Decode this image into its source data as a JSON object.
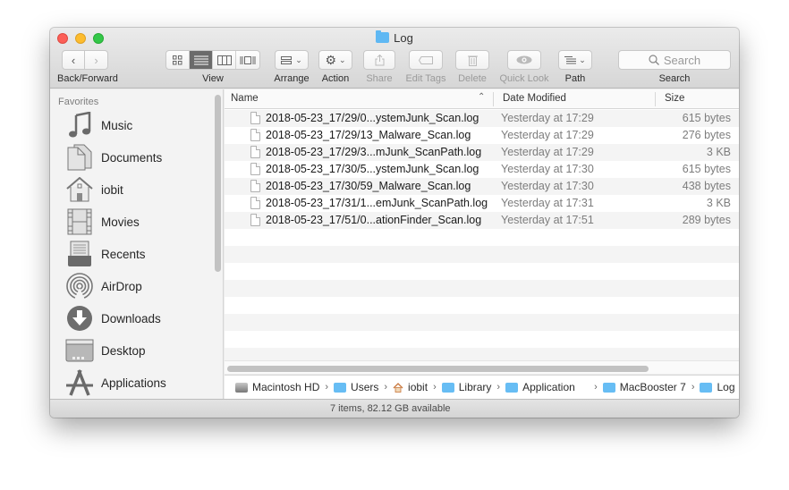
{
  "window": {
    "title": "Log",
    "title_icon": "folder-icon"
  },
  "toolbar": {
    "back_forward_label": "Back/Forward",
    "view_label": "View",
    "view_modes": [
      {
        "name": "icon-view",
        "icon": "grid-icon",
        "active": false
      },
      {
        "name": "list-view",
        "icon": "list-icon",
        "active": true
      },
      {
        "name": "column-view",
        "icon": "columns-icon",
        "active": false
      },
      {
        "name": "cover-flow-view",
        "icon": "cover-flow-icon",
        "active": false
      }
    ],
    "arrange_label": "Arrange",
    "action_label": "Action",
    "share_label": "Share",
    "edit_tags_label": "Edit Tags",
    "delete_label": "Delete",
    "quick_look_label": "Quick Look",
    "path_label": "Path",
    "search_label": "Search",
    "search_placeholder": "Search"
  },
  "sidebar": {
    "heading": "Favorites",
    "items": [
      {
        "label": "Music",
        "icon": "music-icon"
      },
      {
        "label": "Documents",
        "icon": "documents-icon"
      },
      {
        "label": "iobit",
        "icon": "home-icon"
      },
      {
        "label": "Movies",
        "icon": "movies-icon"
      },
      {
        "label": "Recents",
        "icon": "recents-icon"
      },
      {
        "label": "AirDrop",
        "icon": "airdrop-icon"
      },
      {
        "label": "Downloads",
        "icon": "downloads-icon"
      },
      {
        "label": "Desktop",
        "icon": "desktop-icon"
      },
      {
        "label": "Applications",
        "icon": "applications-icon"
      }
    ]
  },
  "columns": {
    "name": "Name",
    "date": "Date Modified",
    "size": "Size",
    "sort_indicator": "^"
  },
  "files": [
    {
      "name": "2018-05-23_17/29/0...ystemJunk_Scan.log",
      "date": "Yesterday at 17:29",
      "size": "615 bytes"
    },
    {
      "name": "2018-05-23_17/29/13_Malware_Scan.log",
      "date": "Yesterday at 17:29",
      "size": "276 bytes"
    },
    {
      "name": "2018-05-23_17/29/3...mJunk_ScanPath.log",
      "date": "Yesterday at 17:29",
      "size": "3 KB"
    },
    {
      "name": "2018-05-23_17/30/5...ystemJunk_Scan.log",
      "date": "Yesterday at 17:30",
      "size": "615 bytes"
    },
    {
      "name": "2018-05-23_17/30/59_Malware_Scan.log",
      "date": "Yesterday at 17:30",
      "size": "438 bytes"
    },
    {
      "name": "2018-05-23_17/31/1...emJunk_ScanPath.log",
      "date": "Yesterday at 17:31",
      "size": "3 KB"
    },
    {
      "name": "2018-05-23_17/51/0...ationFinder_Scan.log",
      "date": "Yesterday at 17:51",
      "size": "289 bytes"
    }
  ],
  "pathbar": [
    {
      "label": "Macintosh HD",
      "icon": "disk-icon"
    },
    {
      "label": "Users",
      "icon": "users-folder-icon"
    },
    {
      "label": "iobit",
      "icon": "home-icon"
    },
    {
      "label": "Library",
      "icon": "library-folder-icon"
    },
    {
      "label": "Application",
      "icon": "folder-icon"
    },
    {
      "label": "MacBooster 7",
      "icon": "folder-icon"
    },
    {
      "label": "Log",
      "icon": "folder-icon"
    }
  ],
  "pathbar_separator": "›",
  "status": {
    "text": "7 items, 82.12 GB available"
  }
}
